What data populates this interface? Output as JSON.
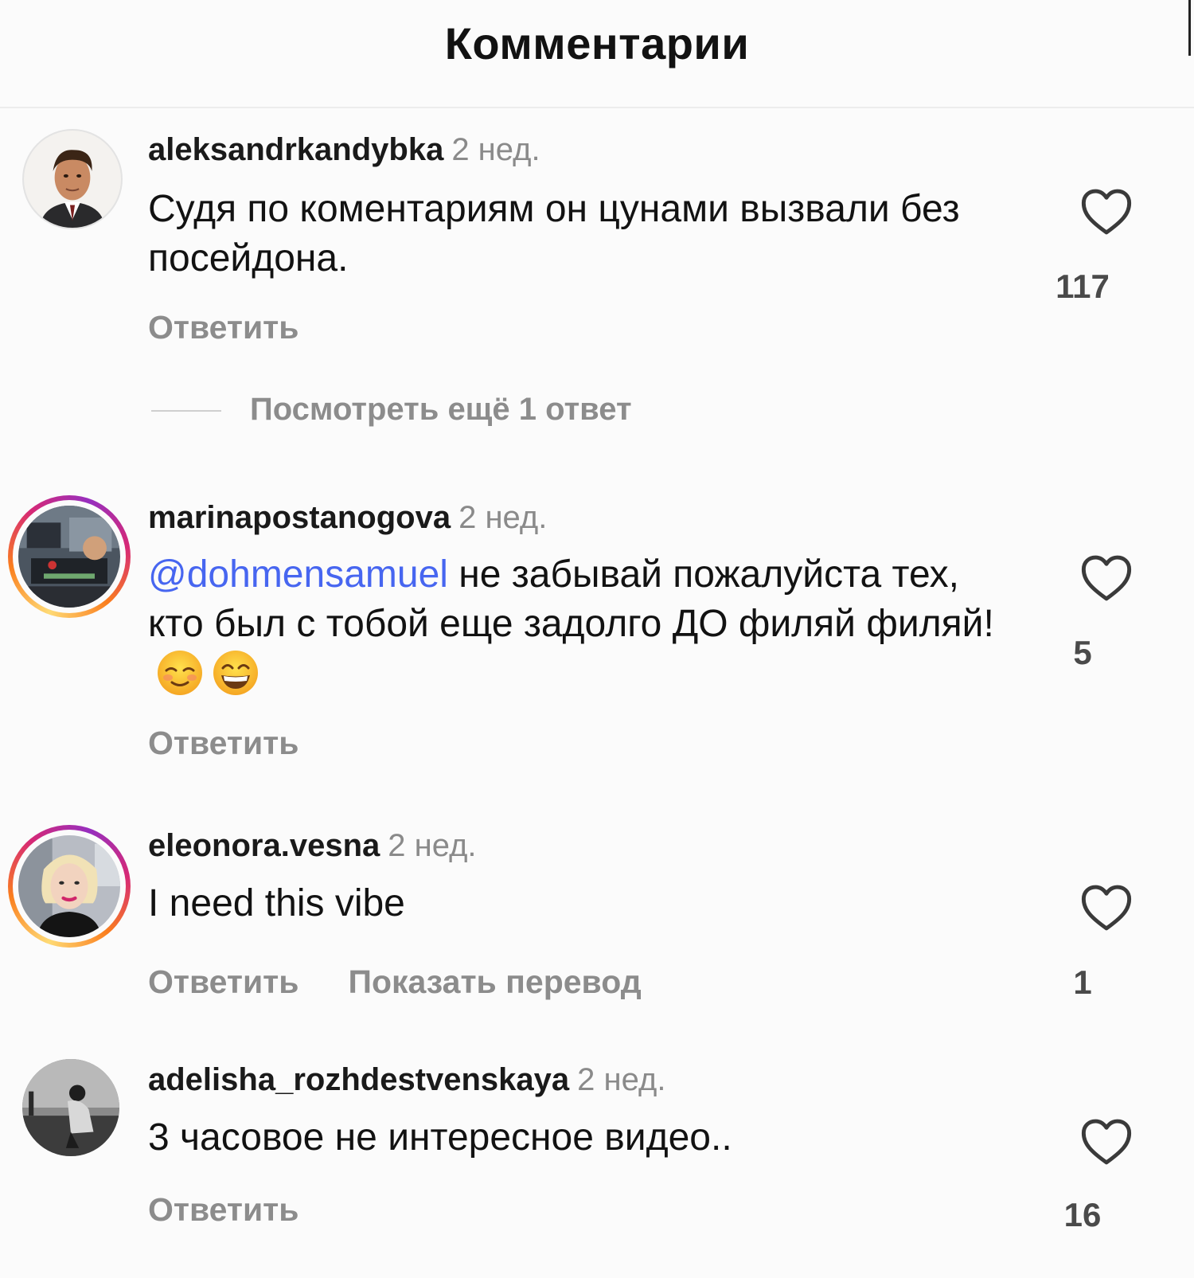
{
  "header": {
    "title": "Комментарии"
  },
  "comments": [
    {
      "username": "aleksandrkandybka",
      "time": "2 нед.",
      "text": "Судя по коментариям он цунами вызвали без  посейдона.",
      "reply_label": "Ответить",
      "likes": "117",
      "more_replies": "Посмотреть ещё 1 ответ"
    },
    {
      "username": "marinapostanogova",
      "time": "2 нед.",
      "mention": "@dohmensamuel",
      "text": " не забывай пожалуйста тех, кто был с тобой еще задолго ДО филяй филяй!",
      "emojis": [
        "smiling-blush-emoji",
        "grinning-emoji"
      ],
      "reply_label": "Ответить",
      "likes": "5"
    },
    {
      "username": "eleonora.vesna",
      "time": "2 нед.",
      "text": "I need this vibe",
      "reply_label": "Ответить",
      "translate_label": "Показать перевод",
      "likes": "1"
    },
    {
      "username": "adelisha_rozhdestvenskaya",
      "time": "2 нед.",
      "text": "3 часовое не интересное видео..",
      "reply_label": "Ответить",
      "likes": "16"
    }
  ],
  "icons": {
    "like": "heart-outline-icon"
  },
  "colors": {
    "mention": "#4766f0",
    "muted": "#8c8c8c",
    "story_ring": [
      "#feda75",
      "#fa7e1e",
      "#d62976",
      "#962fbf"
    ]
  }
}
